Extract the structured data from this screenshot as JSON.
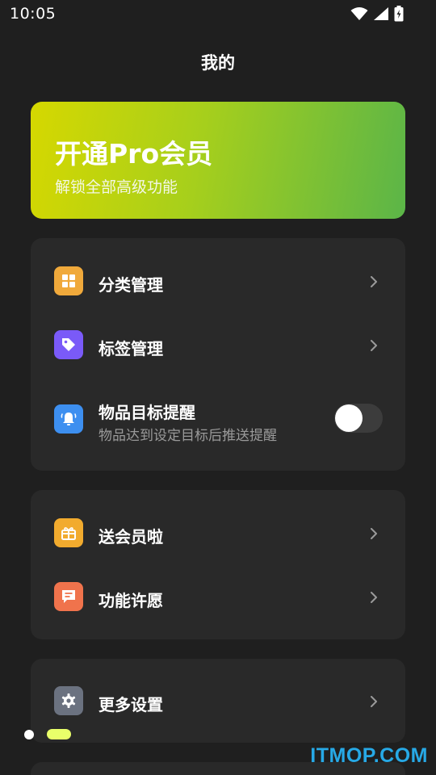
{
  "status_bar": {
    "time": "10:05",
    "icons": [
      "wifi-icon",
      "signal-icon",
      "battery-icon"
    ]
  },
  "header": {
    "title": "我的"
  },
  "pro_banner": {
    "title": "开通Pro会员",
    "subtitle": "解锁全部高级功能",
    "gradient": [
      "#d6d800",
      "#a6cf1c",
      "#5bb548"
    ]
  },
  "card1": {
    "items": [
      {
        "label": "分类管理",
        "icon": "grid-icon",
        "icon_color": "#f0a93b"
      },
      {
        "label": "标签管理",
        "icon": "tag-icon",
        "icon_color": "#7a5af8"
      },
      {
        "label": "物品目标提醒",
        "desc": "物品达到设定目标后推送提醒",
        "icon": "bell-icon",
        "icon_color": "#3d8ff0",
        "toggle_on": false
      }
    ]
  },
  "card2": {
    "items": [
      {
        "label": "送会员啦",
        "icon": "gift-icon",
        "icon_color": "#f2ab2e"
      },
      {
        "label": "功能许愿",
        "icon": "message-icon",
        "icon_color": "#f0734c"
      }
    ]
  },
  "card3": {
    "items": [
      {
        "label": "更多设置",
        "icon": "gear-icon",
        "icon_color": "#6b7280"
      }
    ]
  },
  "pager": {
    "active_index": 1,
    "count": 2,
    "active_color": "#e9ff6a"
  },
  "watermark": {
    "text": "ITMOP.COM",
    "color": "#27a9e6"
  },
  "colors": {
    "background": "#1f1f1f",
    "card": "#292929",
    "secondary_text": "#9a9a9a"
  }
}
